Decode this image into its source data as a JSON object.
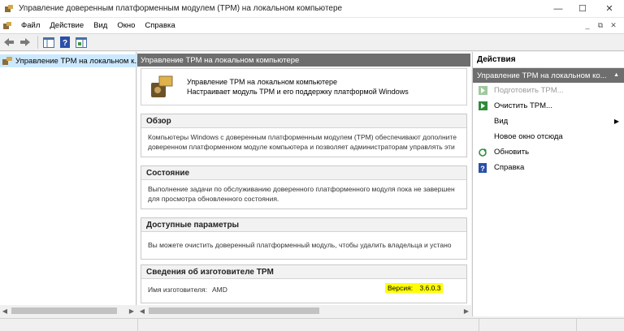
{
  "window": {
    "title": "Управление доверенным платформенным модулем (TPM) на локальном компьютере",
    "controls": {
      "minimize": "—",
      "maximize": "☐",
      "close": "✕"
    }
  },
  "menubar": {
    "items": [
      "Файл",
      "Действие",
      "Вид",
      "Окно",
      "Справка"
    ],
    "right_controls": [
      "_",
      "⧉",
      "✕"
    ]
  },
  "toolbar": {
    "buttons": [
      "back-icon",
      "forward-icon",
      "console-tree-icon",
      "help-icon",
      "show-action-pane-icon"
    ]
  },
  "tree": {
    "root_label": "Управление TPM на локальном к..."
  },
  "center": {
    "header": "Управление TPM на локальном компьютере",
    "intro": {
      "title": "Управление TPM на локальном компьютере",
      "subtitle": "Настраивает модуль TPM и его поддержку платформой Windows"
    },
    "sections": {
      "overview": {
        "heading": "Обзор",
        "line1": "Компьютеры Windows с доверенным платформенным модулем (TPM) обеспечивают дополните",
        "line2": "доверенном платформенном модуле компьютера и позволяет администраторам управлять эти"
      },
      "status": {
        "heading": "Состояние",
        "line1": "Выполнение задачи по обслуживанию доверенного платформенного модуля пока не завершен",
        "line2": "для просмотра обновленного состояния."
      },
      "options": {
        "heading": "Доступные параметры",
        "line1": "Вы можете очистить доверенный платформенный модуль, чтобы удалить владельца и устано"
      },
      "manufacturer": {
        "heading": "Сведения об изготовителе TPM",
        "name_label": "Имя изготовителя:",
        "name_value": "AMD",
        "version_label": "Версия:",
        "version_value": "3.6.0.3",
        "highlight_color": "#ffff00"
      }
    }
  },
  "actions": {
    "heading": "Действия",
    "subheading": "Управление TPM на локальном ко...",
    "items": {
      "prepare": "Подготовить TPM...",
      "clear": "Очистить TPM...",
      "view": "Вид",
      "new_window": "Новое окно отсюда",
      "refresh": "Обновить",
      "help": "Справка"
    }
  },
  "colors": {
    "selection": "#cce8ff",
    "header_gray": "#6e6e6e",
    "action_green": "#2e8b3a"
  }
}
